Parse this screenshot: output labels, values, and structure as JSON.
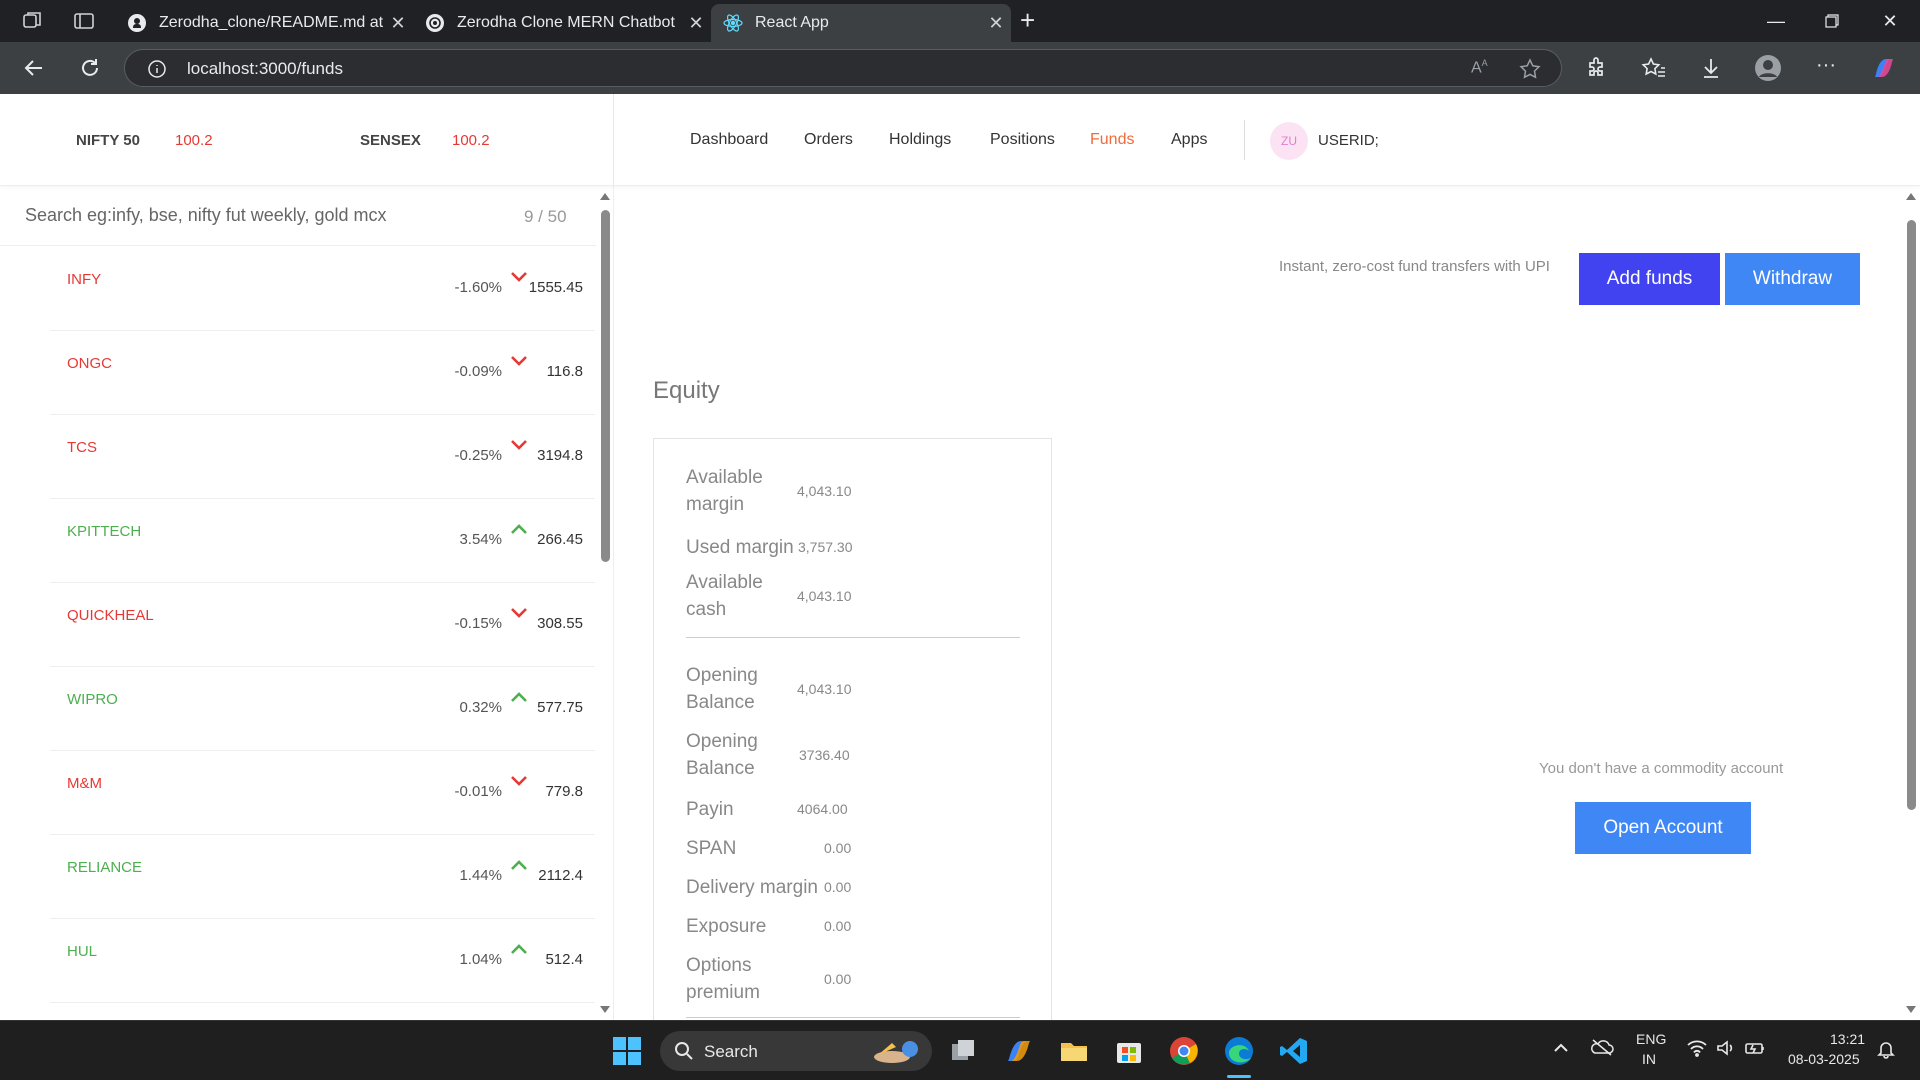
{
  "browser": {
    "tabs": [
      {
        "title": "Zerodha_clone/README.md at m",
        "icon": "github-icon"
      },
      {
        "title": "Zerodha Clone MERN Chatbot",
        "icon": "openai-icon"
      },
      {
        "title": "React App",
        "icon": "react-icon",
        "active": true
      }
    ],
    "url": "localhost:3000/funds"
  },
  "indices": {
    "nifty": {
      "name": "NIFTY 50",
      "value": "100.2"
    },
    "sensex": {
      "name": "SENSEX",
      "value": "100.2"
    }
  },
  "menu": {
    "dashboard": "Dashboard",
    "orders": "Orders",
    "holdings": "Holdings",
    "positions": "Positions",
    "funds": "Funds",
    "apps": "Apps"
  },
  "user": {
    "initials": "ZU",
    "id": "USERID;"
  },
  "watchlist": {
    "placeholder": "Search eg:infy, bse, nifty fut weekly, gold mcx",
    "count": "9 / 50",
    "stocks": [
      {
        "name": "INFY",
        "percent": "-1.60%",
        "price": "1555.45",
        "down": true
      },
      {
        "name": "ONGC",
        "percent": "-0.09%",
        "price": "116.8",
        "down": true
      },
      {
        "name": "TCS",
        "percent": "-0.25%",
        "price": "3194.8",
        "down": true
      },
      {
        "name": "KPITTECH",
        "percent": "3.54%",
        "price": "266.45",
        "down": false
      },
      {
        "name": "QUICKHEAL",
        "percent": "-0.15%",
        "price": "308.55",
        "down": true
      },
      {
        "name": "WIPRO",
        "percent": "0.32%",
        "price": "577.75",
        "down": false
      },
      {
        "name": "M&M",
        "percent": "-0.01%",
        "price": "779.8",
        "down": true
      },
      {
        "name": "RELIANCE",
        "percent": "1.44%",
        "price": "2112.4",
        "down": false
      },
      {
        "name": "HUL",
        "percent": "1.04%",
        "price": "512.4",
        "down": false
      }
    ]
  },
  "funds": {
    "upi_text": "Instant, zero-cost fund transfers with UPI",
    "add_funds": "Add funds",
    "withdraw": "Withdraw",
    "equity_title": "Equity",
    "rows": [
      {
        "label": "Available margin",
        "value": "4,043.10"
      },
      {
        "label": "Used margin",
        "value": "3,757.30"
      },
      {
        "label": "Available cash",
        "value": "4,043.10"
      },
      {
        "label": "Opening Balance",
        "value": "4,043.10"
      },
      {
        "label": "Opening Balance",
        "value": "3736.40"
      },
      {
        "label": "Payin",
        "value": "4064.00"
      },
      {
        "label": "SPAN",
        "value": "0.00"
      },
      {
        "label": "Delivery margin",
        "value": "0.00"
      },
      {
        "label": "Exposure",
        "value": "0.00"
      },
      {
        "label": "Options premium",
        "value": "0.00"
      }
    ],
    "commodity_text": "You don't have a commodity account",
    "open_account": "Open Account"
  },
  "taskbar": {
    "search": "Search",
    "lang": "ENG",
    "region": "IN",
    "time": "13:21",
    "date": "08-03-2025"
  },
  "colors": {
    "accent": "#4243f0",
    "blue": "#3f87f5",
    "loss": "#e53935",
    "gain": "#4caf50",
    "active_menu": "#ef6c3a"
  }
}
